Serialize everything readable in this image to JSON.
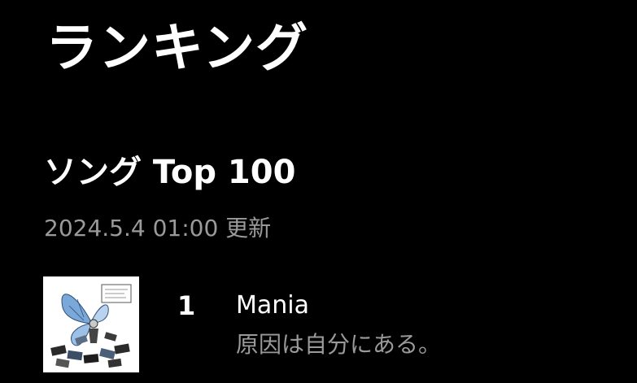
{
  "page": {
    "title": "ランキング"
  },
  "section": {
    "title": "ソング Top 100",
    "updated": "2024.5.4 01:00 更新"
  },
  "ranking": [
    {
      "rank": "1",
      "title": "Mania",
      "artist": "原因は自分にある。",
      "artwork_icon": "album-artwork"
    }
  ]
}
